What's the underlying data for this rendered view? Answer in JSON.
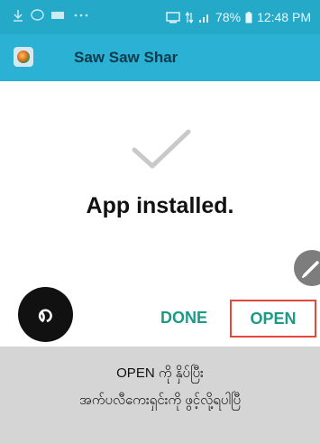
{
  "status_bar": {
    "time": "12:48 PM",
    "battery": "78%"
  },
  "app_bar": {
    "title": "Saw Saw Shar"
  },
  "main": {
    "message": "App installed.",
    "step_number": "၈"
  },
  "actions": {
    "done_label": "DONE",
    "open_label": "OPEN"
  },
  "caption": {
    "line1": "OPEN ကို နှိပ်ပြီး",
    "line2": "အက်ပလီကေးရှင်းကို ဖွင့်လို့ရပါပြီ"
  },
  "colors": {
    "status_bar": "#25a9c9",
    "app_bar": "#2ab1d4",
    "action_text": "#1c9a86",
    "highlight_border": "#e5483b",
    "caption_bg": "#d5d5d5"
  }
}
